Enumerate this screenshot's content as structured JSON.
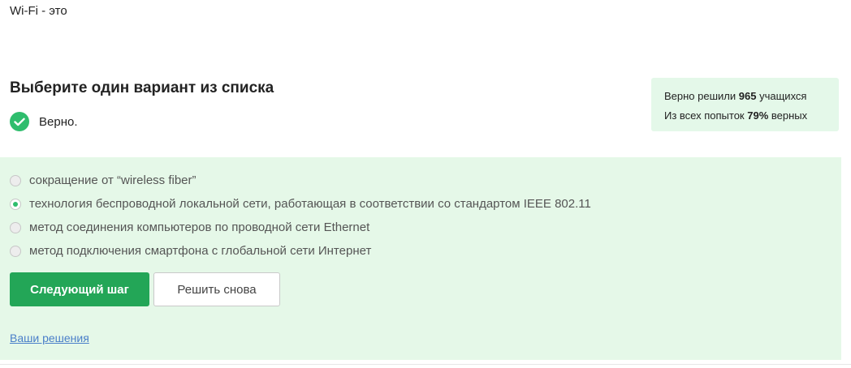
{
  "question": {
    "text": "Wi-Fi - это"
  },
  "instruction": "Выберите один вариант из списка",
  "result": {
    "text": "Верно.",
    "icon": "check-icon",
    "color": "#2fbd6d"
  },
  "stats": {
    "line1_prefix": "Верно решили",
    "solved_count": "965",
    "line1_suffix": "учащихся",
    "line2_prefix": "Из всех попыток",
    "correct_percent": "79%",
    "line2_suffix": "верных"
  },
  "options": [
    {
      "label": "сокращение от “wireless fiber”",
      "selected": false
    },
    {
      "label": "технология беспроводной локальной сети, работающая в соответствии со стандартом IEEE 802.11",
      "selected": true
    },
    {
      "label": "метод соединения компьютеров по проводной сети Ethernet",
      "selected": false
    },
    {
      "label": "метод подключения смартфона с глобальной сети Интернет",
      "selected": false
    }
  ],
  "buttons": {
    "next_step": "Следующий шаг",
    "retry": "Решить снова"
  },
  "links": {
    "your_solutions": "Ваши решения"
  },
  "colors": {
    "accent_green": "#23a657",
    "panel_bg": "#e5f8e8",
    "link_blue": "#4a7fc9"
  }
}
